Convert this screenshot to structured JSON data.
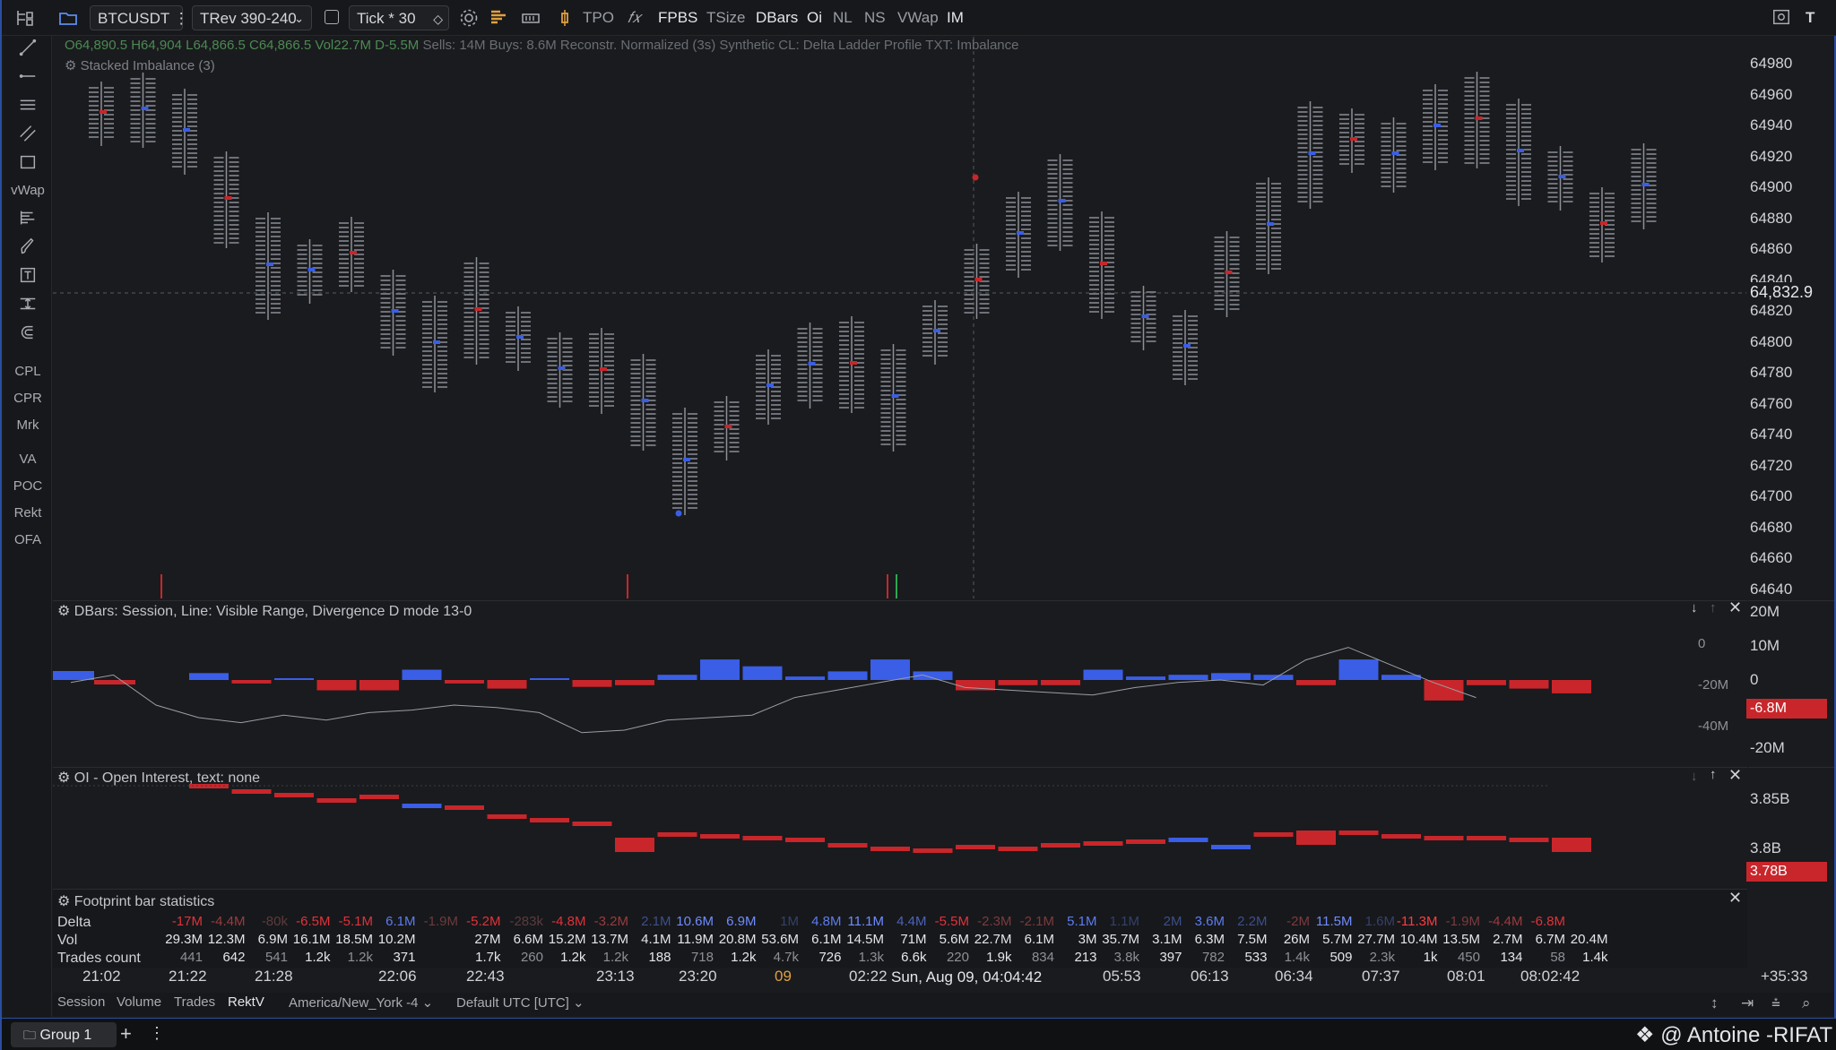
{
  "toolbar": {
    "symbol": "BTCUSDT",
    "symbol_suffix": "⋮",
    "bar_type": "TRev 390-240",
    "tick_label": "Tick *",
    "tick_value": "30",
    "items": [
      "TPO",
      "FPBS",
      "TSize",
      "DBars",
      "Oi",
      "NL",
      "NS",
      "VWap",
      "IM"
    ],
    "right_letter": "T"
  },
  "left_tools": {
    "labels": [
      "vWap",
      "CPL",
      "CPR",
      "Mrk",
      "VA",
      "POC",
      "Rekt",
      "OFA"
    ]
  },
  "main_pane": {
    "ohlc_text": "O64,890.5 H64,904 L64,866.5 C64,866.5",
    "vol_text": "Vol22.7M D-5.5M",
    "sells_text": "Sells: 14M Buys: 8.6M",
    "mode_text": "Reconstr.  Normalized (3s)  Synthetic  CL: Delta Ladder Profile TXT: Imbalance",
    "indicator": "Stacked Imbalance (3)",
    "price_ticks": [
      "64980",
      "64960",
      "64940",
      "64920",
      "64900",
      "64880",
      "64860",
      "64840",
      "64820",
      "64800",
      "64780",
      "64760",
      "64740",
      "64720",
      "64700",
      "64680",
      "64660",
      "64640"
    ],
    "crosshair_price": "64,832.9"
  },
  "dbars_pane": {
    "title": "DBars: Session, Line: Visible Range, Divergence D mode 13-0",
    "left_ticks": [
      "0",
      "-20M",
      "-40M"
    ],
    "right_ticks": [
      "20M",
      "10M",
      "0",
      "-20M"
    ],
    "last_value": "-6.8M",
    "colors": {
      "up": "#3a5ee6",
      "down": "#c8262b"
    }
  },
  "oi_pane": {
    "title": "OI - Open Interest, text: none",
    "right_ticks": [
      "3.85B",
      "3.8B"
    ],
    "last_value": "3.78B"
  },
  "stats": {
    "title": "Footprint bar statistics",
    "row_labels": [
      "Delta",
      "Vol",
      "Trades count"
    ],
    "delta": [
      {
        "v": "-17M",
        "c": "#e0323a"
      },
      {
        "v": "-4.4M",
        "c": "#9a3b3e"
      },
      {
        "v": "-80k",
        "c": "#5a3b3e"
      },
      {
        "v": "-6.5M",
        "c": "#e0323a"
      },
      {
        "v": "-5.1M",
        "c": "#e0323a"
      },
      {
        "v": "6.1M",
        "c": "#5b7cf0"
      },
      {
        "v": "-1.9M",
        "c": "#6a3b3e"
      },
      {
        "v": "-5.2M",
        "c": "#e0323a"
      },
      {
        "v": "-283k",
        "c": "#5a3b3e"
      },
      {
        "v": "-4.8M",
        "c": "#e0323a"
      },
      {
        "v": "-3.2M",
        "c": "#9a3b3e"
      },
      {
        "v": "2.1M",
        "c": "#3c4f8a"
      },
      {
        "v": "10.6M",
        "c": "#6f8cff"
      },
      {
        "v": "6.9M",
        "c": "#6f8cff"
      },
      {
        "v": "1M",
        "c": "#34406a"
      },
      {
        "v": "4.8M",
        "c": "#5b7cf0"
      },
      {
        "v": "11.1M",
        "c": "#6f8cff"
      },
      {
        "v": "4.4M",
        "c": "#4b62b8"
      },
      {
        "v": "-5.5M",
        "c": "#e0323a"
      },
      {
        "v": "-2.3M",
        "c": "#7a3b3e"
      },
      {
        "v": "-2.1M",
        "c": "#7a3b3e"
      },
      {
        "v": "5.1M",
        "c": "#5b7cf0"
      },
      {
        "v": "1.1M",
        "c": "#34406a"
      },
      {
        "v": "2M",
        "c": "#3c4f8a"
      },
      {
        "v": "3.6M",
        "c": "#5b7cf0"
      },
      {
        "v": "2.2M",
        "c": "#3c4f8a"
      },
      {
        "v": "-2M",
        "c": "#7a3b3e"
      },
      {
        "v": "11.5M",
        "c": "#6f8cff"
      },
      {
        "v": "1.6M",
        "c": "#34406a"
      },
      {
        "v": "-11.3M",
        "c": "#ff3a3f"
      },
      {
        "v": "-1.9M",
        "c": "#7a3b3e"
      },
      {
        "v": "-4.4M",
        "c": "#9a3b3e"
      },
      {
        "v": "-6.8M",
        "c": "#e0323a"
      }
    ],
    "vol": [
      "29.3M",
      "12.3M",
      "6.9M",
      "16.1M",
      "18.5M",
      "10.2M",
      "",
      "27M",
      "6.6M",
      "15.2M",
      "13.7M",
      "4.1M",
      "11.9M",
      "20.8M",
      "53.6M",
      "6.1M",
      "14.5M",
      "71M",
      "5.6M",
      "22.7M",
      "6.1M",
      "3M",
      "35.7M",
      "3.1M",
      "6.3M",
      "7.5M",
      "26M",
      "5.7M",
      "27.7M",
      "10.4M",
      "13.5M",
      "2.7M",
      "6.7M",
      "20.4M"
    ],
    "trades": [
      "441",
      "642",
      "541",
      "1.2k",
      "1.2k",
      "371",
      "",
      "1.7k",
      "260",
      "1.2k",
      "1.2k",
      "188",
      "718",
      "1.2k",
      "4.7k",
      "726",
      "1.3k",
      "6.6k",
      "220",
      "1.9k",
      "834",
      "213",
      "3.8k",
      "397",
      "782",
      "533",
      "1.4k",
      "509",
      "2.3k",
      "1k",
      "450",
      "134",
      "58",
      "1.4k"
    ]
  },
  "x_axis": {
    "labels": [
      "21:02",
      "21:22",
      "21:28",
      "22:06",
      "22:43",
      "23:13",
      "23:20",
      "09",
      "02:22",
      "05:53",
      "06:13",
      "06:34",
      "07:37",
      "08:01",
      "08:02:42"
    ],
    "crosshair_time": "Sun, Aug 09, 04:04:42",
    "right_text": "+35:33"
  },
  "bottom_bar": {
    "items": [
      "Session",
      "Volume",
      "Trades",
      "RektV"
    ],
    "timezone": "America/New_York -4",
    "utc": "Default UTC [UTC]"
  },
  "group_bar": {
    "group": "Group 1",
    "watermark": "@ Antoine -RIFAT"
  },
  "chart_data": {
    "type": "bar",
    "title": "",
    "series": [
      {
        "name": "",
        "values": [
          3,
          -1,
          0,
          -5,
          -5,
          5,
          -1,
          -4,
          0,
          -3,
          -2,
          2,
          11,
          7,
          1,
          4,
          11,
          4,
          -5,
          -2,
          -2,
          5,
          1,
          2,
          3,
          2,
          -2,
          11,
          2,
          -11,
          -2,
          -4,
          -6.8
        ]
      }
    ],
    "ylim": [
      -20,
      20
    ],
    "grid": false
  }
}
